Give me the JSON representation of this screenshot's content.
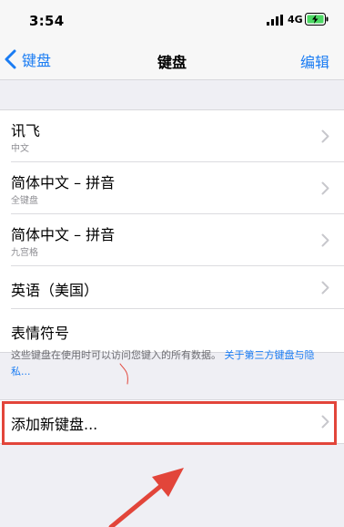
{
  "status_bar": {
    "time": "3:54",
    "network": "4G"
  },
  "nav": {
    "back_label": "键盘",
    "title": "键盘",
    "edit_label": "编辑"
  },
  "keyboards": [
    {
      "title": "讯飞",
      "subtitle": "中文"
    },
    {
      "title": "简体中文 – 拼音",
      "subtitle": "全键盘"
    },
    {
      "title": "简体中文 – 拼音",
      "subtitle": "九宫格"
    },
    {
      "title": "英语（美国）"
    },
    {
      "title": "表情符号"
    }
  ],
  "footer": {
    "text": "这些键盘在使用时可以访问您键入的所有数据。",
    "link": "关于第三方键盘与隐私..."
  },
  "add_keyboard": {
    "label": "添加新键盘..."
  },
  "colors": {
    "accent": "#1a7cf3",
    "annotation": "#e2453a"
  }
}
